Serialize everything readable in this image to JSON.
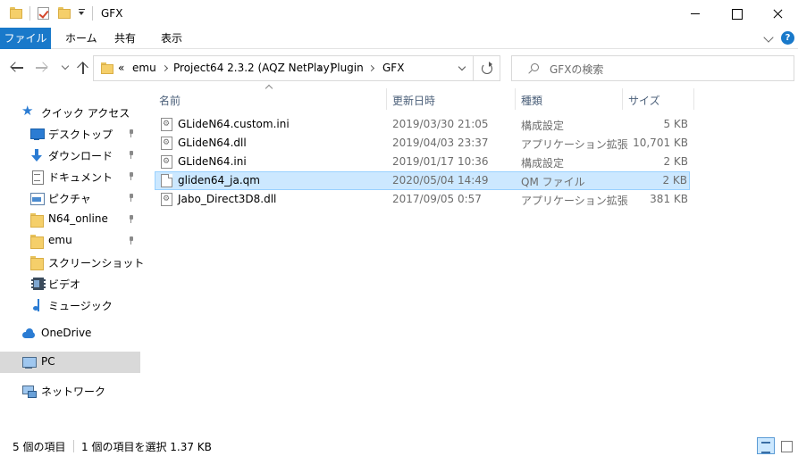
{
  "window": {
    "title": "GFX"
  },
  "ribbon": {
    "tabs": [
      {
        "label": "ファイル"
      },
      {
        "label": "ホーム"
      },
      {
        "label": "共有"
      },
      {
        "label": "表示"
      }
    ]
  },
  "address": {
    "overflow": "«",
    "crumbs": [
      "emu",
      "Project64 2.3.2 (AQZ NetPlay)",
      "Plugin",
      "GFX"
    ]
  },
  "search": {
    "placeholder": "GFXの検索"
  },
  "nav": {
    "items": [
      {
        "label": "クイック アクセス",
        "icon": "star-icon"
      },
      {
        "label": "デスクトップ",
        "icon": "desktop-icon",
        "pinned": true
      },
      {
        "label": "ダウンロード",
        "icon": "download-icon",
        "pinned": true
      },
      {
        "label": "ドキュメント",
        "icon": "document-icon",
        "pinned": true
      },
      {
        "label": "ピクチャ",
        "icon": "pictures-icon",
        "pinned": true
      },
      {
        "label": "N64_online",
        "icon": "folder-icon",
        "pinned": true
      },
      {
        "label": "emu",
        "icon": "folder-icon",
        "pinned": true
      },
      {
        "label": "スクリーンショット",
        "icon": "folder-icon"
      },
      {
        "label": "ビデオ",
        "icon": "video-icon"
      },
      {
        "label": "ミュージック",
        "icon": "music-icon"
      },
      {
        "label": "OneDrive",
        "icon": "onedrive-icon"
      },
      {
        "label": "PC",
        "icon": "pc-icon",
        "selected": true
      },
      {
        "label": "ネットワーク",
        "icon": "network-icon"
      }
    ]
  },
  "filelist": {
    "columns": {
      "name": "名前",
      "date": "更新日時",
      "type": "種類",
      "size": "サイズ"
    },
    "rows": [
      {
        "name": "GLideN64.custom.ini",
        "date": "2019/03/30 21:05",
        "type": "構成設定",
        "size": "5 KB",
        "icon": "settings-file-icon"
      },
      {
        "name": "GLideN64.dll",
        "date": "2019/04/03 23:37",
        "type": "アプリケーション拡張",
        "size": "10,701 KB",
        "icon": "settings-file-icon"
      },
      {
        "name": "GLideN64.ini",
        "date": "2019/01/17 10:36",
        "type": "構成設定",
        "size": "2 KB",
        "icon": "settings-file-icon"
      },
      {
        "name": "gliden64_ja.qm",
        "date": "2020/05/04 14:49",
        "type": "QM ファイル",
        "size": "2 KB",
        "icon": "file-icon",
        "selected": true
      },
      {
        "name": "Jabo_Direct3D8.dll",
        "date": "2017/09/05 0:57",
        "type": "アプリケーション拡張",
        "size": "381 KB",
        "icon": "settings-file-icon"
      }
    ]
  },
  "status": {
    "item_count": "5 個の項目",
    "selection": "1 個の項目を選択  1.37 KB"
  },
  "colors": {
    "accent": "#1979ca",
    "selection_bg": "#cce8ff",
    "selection_border": "#99d1ff",
    "nav_selected": "#d9d9d9",
    "header_text": "#4c607a"
  }
}
